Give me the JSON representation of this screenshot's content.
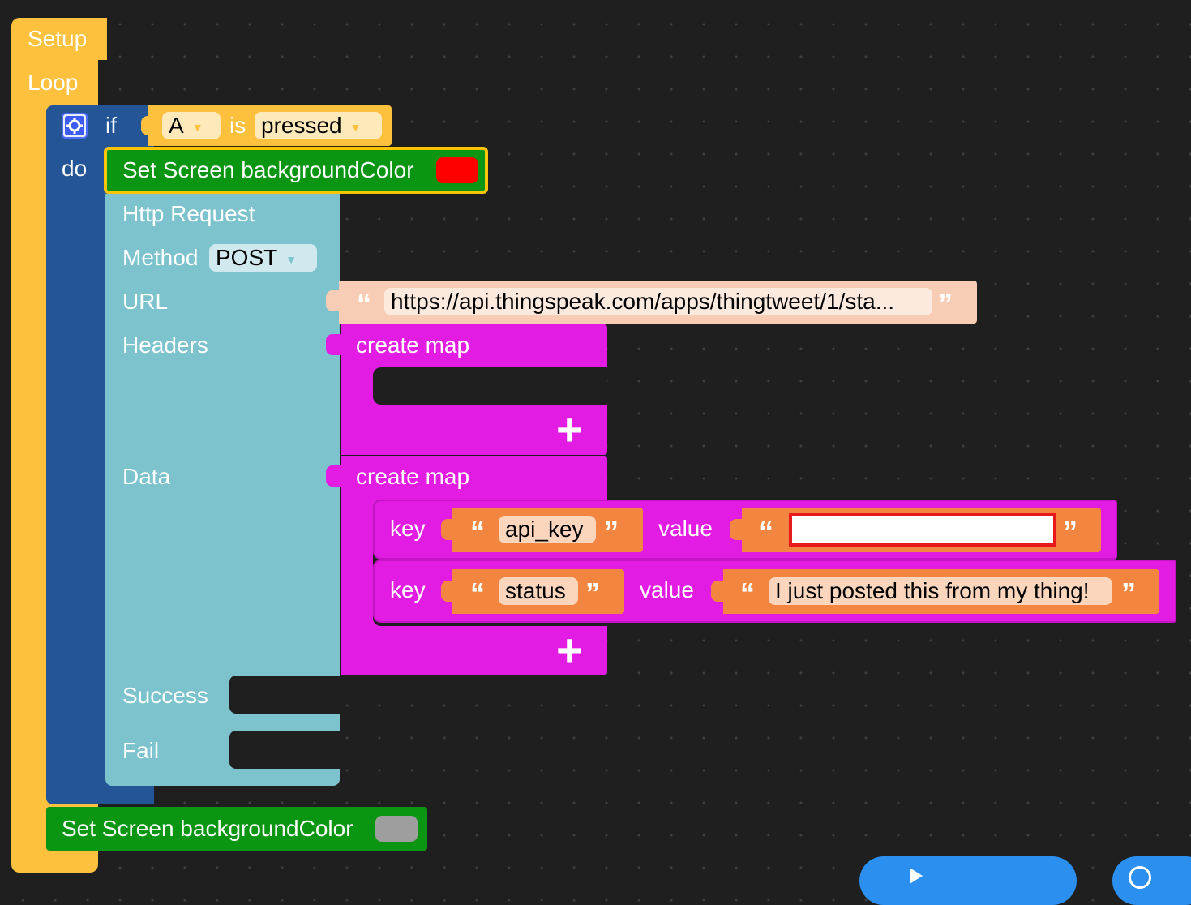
{
  "events": {
    "setup_label": "Setup",
    "loop_label": "Loop"
  },
  "if_block": {
    "if_label": "if",
    "do_label": "do",
    "button_value": "A",
    "is_label": "is",
    "state_value": "pressed"
  },
  "set_screen_1": {
    "label": "Set Screen backgroundColor",
    "color": "#ff0000"
  },
  "http": {
    "title": "Http Request",
    "method_label": "Method",
    "method_value": "POST",
    "url_label": "URL",
    "url_value": "https://api.thingspeak.com/apps/thingtweet/1/sta...",
    "headers_label": "Headers",
    "data_label": "Data",
    "success_label": "Success",
    "fail_label": "Fail"
  },
  "headers_map": {
    "label": "create map"
  },
  "data_map": {
    "label": "create map",
    "rows": [
      {
        "key_label": "key",
        "key": "api_key",
        "value_label": "value",
        "value": ""
      },
      {
        "key_label": "key",
        "key": "status",
        "value_label": "value",
        "value": "I just posted this from my thing!"
      }
    ]
  },
  "set_screen_2": {
    "label": "Set Screen backgroundColor",
    "color": "#9e9e9e"
  },
  "colors": {
    "event": "#fdc13e",
    "logic": "#245596",
    "http": "#7cc3cd",
    "screen": "#0a9612",
    "map": "#e31ce3",
    "text": "#f9cdb5",
    "text_inner": "#f2853f",
    "fab": "#2b8ff0"
  }
}
